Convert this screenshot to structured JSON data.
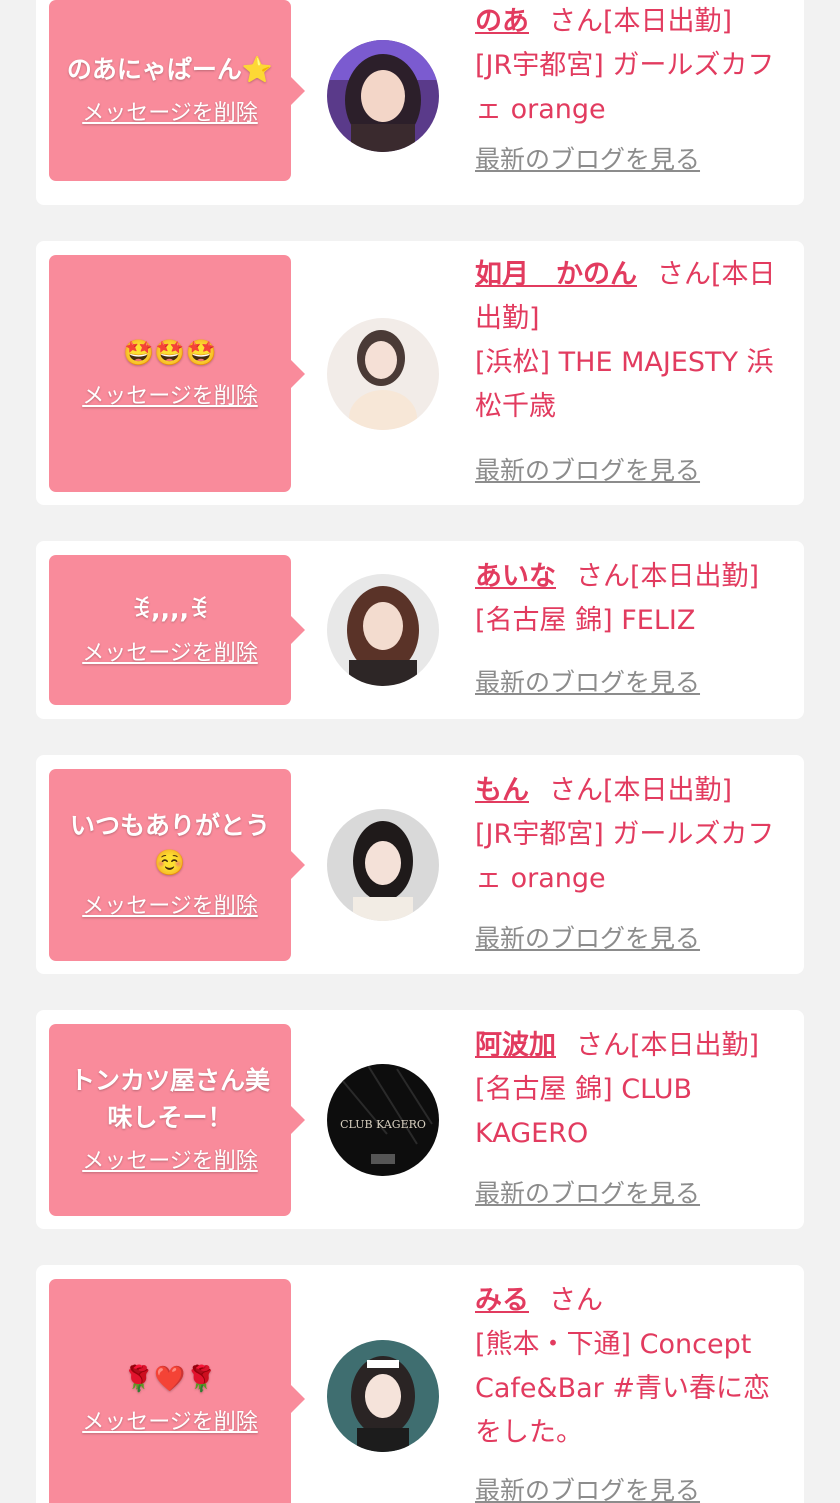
{
  "cards": [
    {
      "message": "のあにゃぱーん⭐",
      "delete_label": "メッセージを削除",
      "name": "のあ",
      "suffix": "さん[本日出勤]",
      "shop": "[JR宇都宮] ガールズカフェ orange",
      "blog_label": "最新のブログを見る"
    },
    {
      "message": "🤩🤩🤩",
      "delete_label": "メッセージを削除",
      "name": "如月　かのん",
      "suffix": "さん[本日出勤]",
      "shop": "[浜松] THE MAJESTY 浜松千歳",
      "blog_label": "最新のブログを見る"
    },
    {
      "message": "ꉂ,,,,ꉂ",
      "delete_label": "メッセージを削除",
      "name": "あいな",
      "suffix": "さん[本日出勤]",
      "shop": "[名古屋 錦] FELIZ",
      "blog_label": "最新のブログを見る"
    },
    {
      "message": "いつもありがとう☺️",
      "delete_label": "メッセージを削除",
      "name": "もん",
      "suffix": "さん[本日出勤]",
      "shop": "[JR宇都宮] ガールズカフェ orange",
      "blog_label": "最新のブログを見る"
    },
    {
      "message": "トンカツ屋さん美味しそー！",
      "delete_label": "メッセージを削除",
      "name": "阿波加",
      "suffix": "さん[本日出勤]",
      "shop": "[名古屋 錦] CLUB KAGERO",
      "blog_label": "最新のブログを見る",
      "avatar_text": "CLUB KAGERO"
    },
    {
      "message": "🌹❤️🌹",
      "delete_label": "メッセージを削除",
      "name": "みる",
      "suffix": "さん",
      "shop": "[熊本・下通] Concept Cafe&Bar #青い春に恋をした。",
      "blog_label": "最新のブログを見る"
    }
  ],
  "colors": {
    "background": "#f2f2f2",
    "bubble": "#f98b9b",
    "accent": "#e23b5f",
    "link_gray": "#8c8c8c"
  }
}
